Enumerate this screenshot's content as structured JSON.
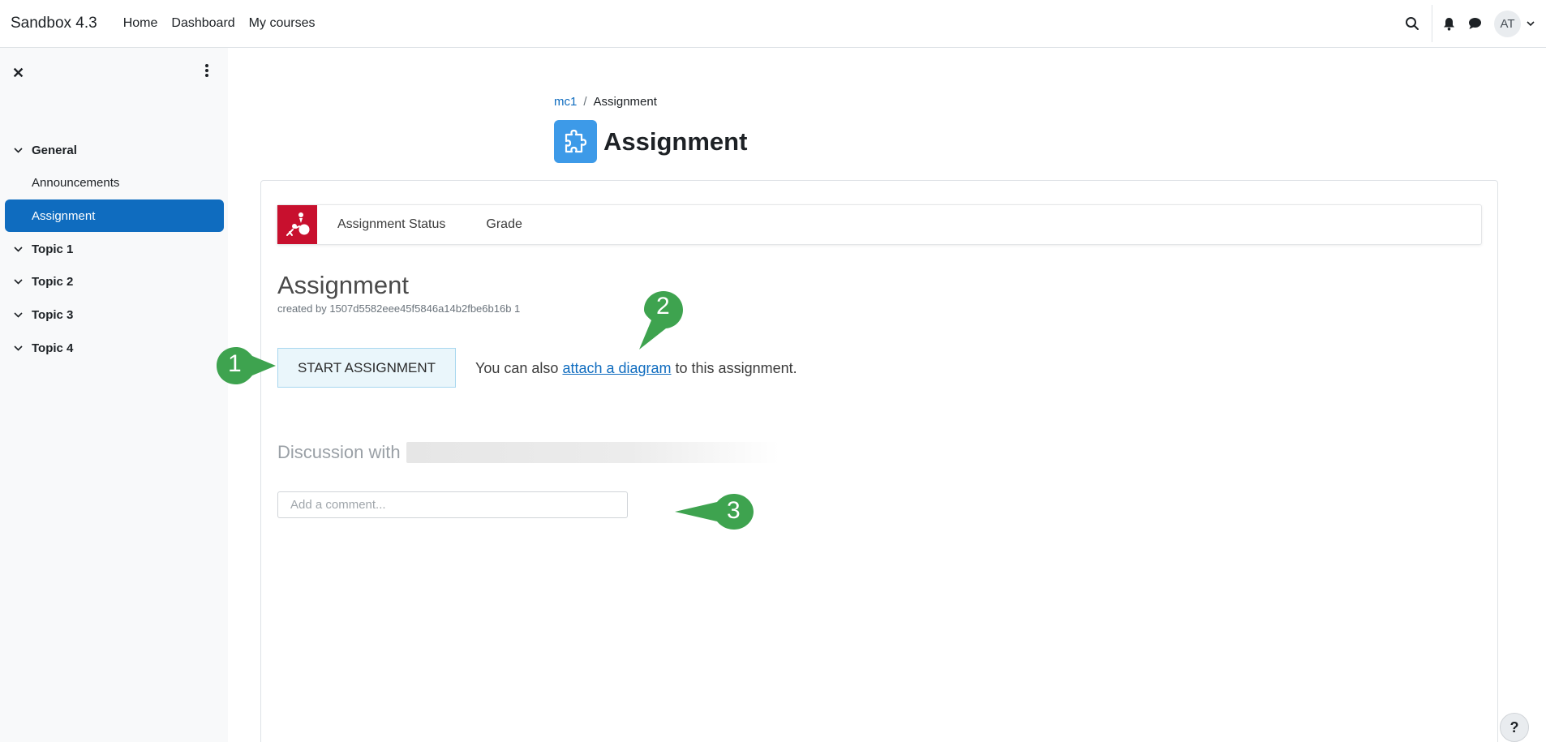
{
  "navbar": {
    "brand": "Sandbox 4.3",
    "links": [
      "Home",
      "Dashboard",
      "My courses"
    ],
    "avatar_initials": "AT",
    "icons": [
      "search-icon",
      "bell-icon",
      "chat-icon",
      "chevron-down-icon"
    ]
  },
  "drawer": {
    "close_symbol": "✕",
    "sections": [
      {
        "label": "General",
        "items": [
          "Announcements",
          "Assignment"
        ]
      },
      {
        "label": "Topic 1"
      },
      {
        "label": "Topic 2"
      },
      {
        "label": "Topic 3"
      },
      {
        "label": "Topic 4"
      }
    ],
    "active_item": "Assignment"
  },
  "breadcrumb": {
    "course": "mc1",
    "separator": "/",
    "current": "Assignment"
  },
  "page": {
    "title": "Assignment",
    "icon": "puzzle-piece-icon",
    "icon_color": "#3d9ae8"
  },
  "plugin": {
    "logo_color": "#c8102e",
    "tabs": [
      "Assignment Status",
      "Grade"
    ],
    "heading": "Assignment",
    "created_by": "created by 1507d5582eee45f5846a14b2fbe6b16b 1",
    "start_button": "START ASSIGNMENT",
    "attach_prefix": "You can also",
    "attach_link": "attach a diagram",
    "attach_suffix": "to this assignment.",
    "discussion_label": "Discussion with",
    "comment_placeholder": "Add a comment..."
  },
  "callouts": [
    "1",
    "2",
    "3"
  ],
  "callout_color": "#3ea34f",
  "help_label": "?"
}
